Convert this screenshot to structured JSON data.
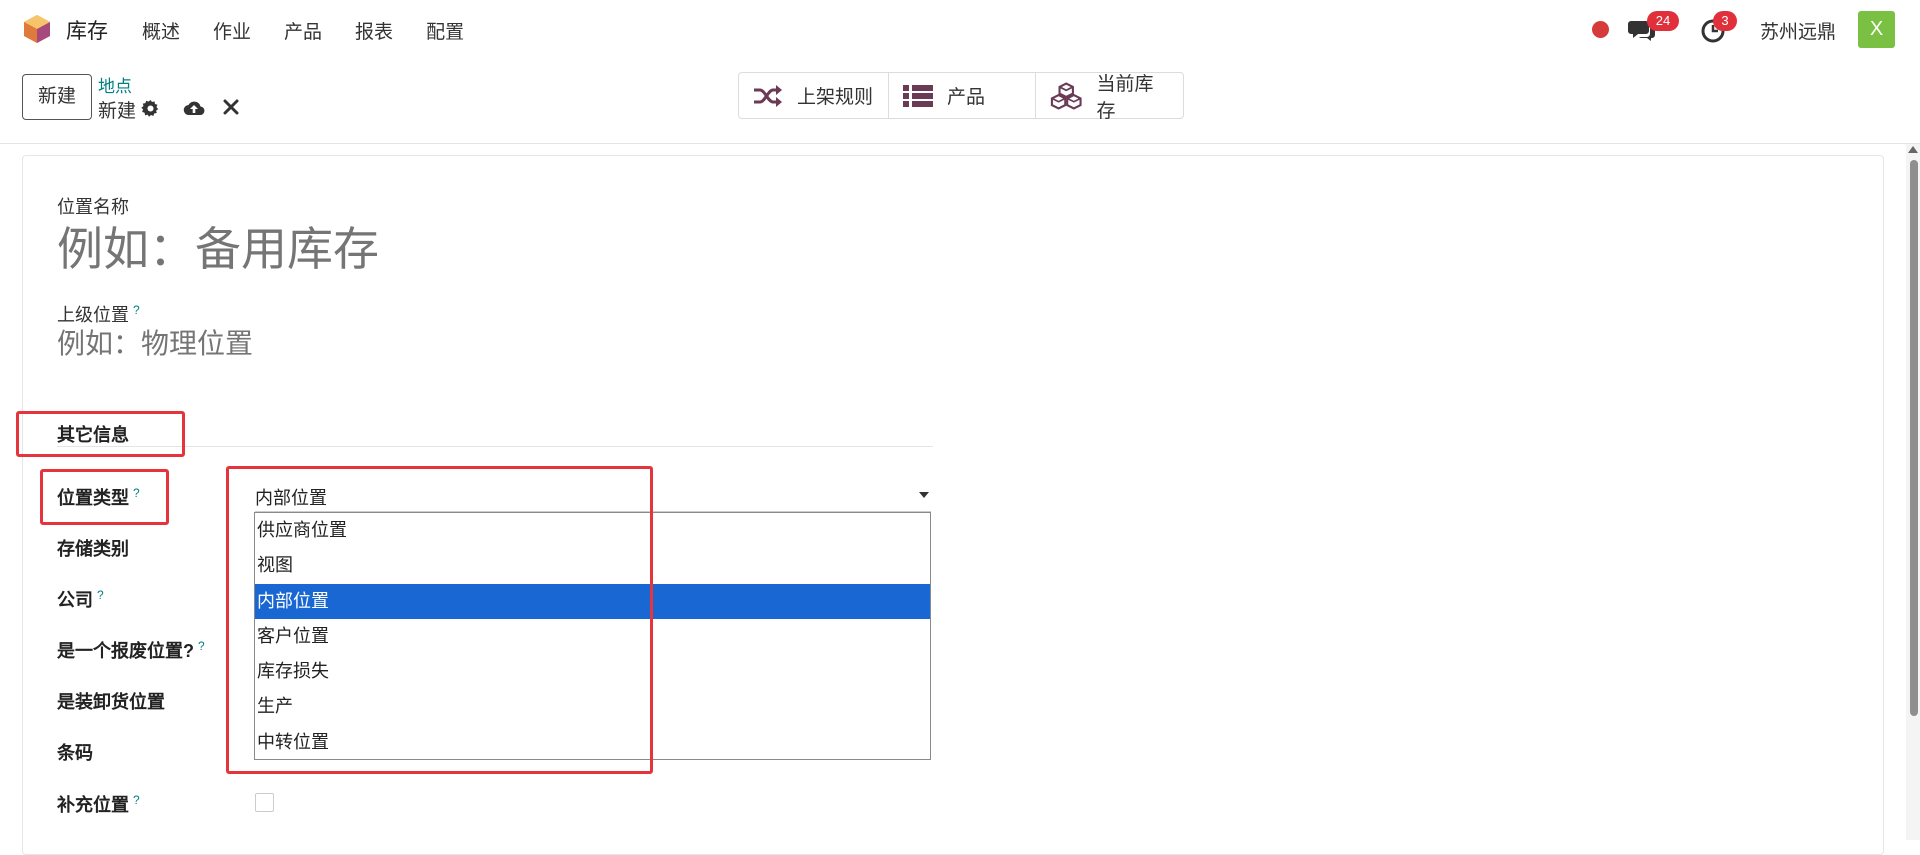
{
  "navbar": {
    "app_name": "库存",
    "menu": [
      "概述",
      "作业",
      "产品",
      "报表",
      "配置"
    ],
    "messages_count": "24",
    "activities_count": "3",
    "company": "苏州远鼎",
    "avatar_letter": "X"
  },
  "control": {
    "new_button": "新建",
    "breadcrumb_parent": "地点",
    "breadcrumb_current": "新建",
    "smart_buttons": [
      "上架规则",
      "产品",
      "当前库存"
    ]
  },
  "form": {
    "name_label": "位置名称",
    "name_placeholder": "例如：备用库存",
    "parent_label": "上级位置",
    "parent_placeholder": "例如：物理位置",
    "help_mark": "?",
    "section_title": "其它信息",
    "fields": [
      "位置类型",
      "存储类别",
      "公司",
      "是一个报废位置?",
      "是装卸货位置",
      "条码",
      "补充位置"
    ],
    "location_type_value": "内部位置",
    "location_type_options": [
      "供应商位置",
      "视图",
      "内部位置",
      "客户位置",
      "库存损失",
      "生产",
      "中转位置"
    ],
    "selected_option_index": 2
  },
  "colors": {
    "accent": "#017e84",
    "selected_option": "#1967d2",
    "highlight": "#e5343b",
    "badge": "#e0303b",
    "avatar": "#7ac143"
  }
}
